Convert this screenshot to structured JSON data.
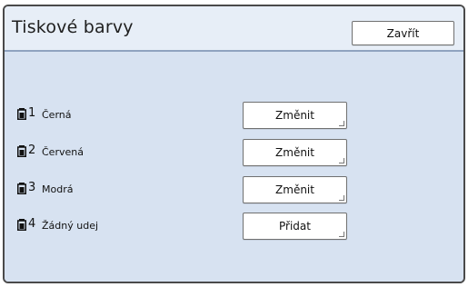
{
  "header": {
    "title": "Tiskové barvy",
    "close_label": "Zavřít"
  },
  "drums": [
    {
      "number": "1",
      "color_name": "Černá",
      "action_label": "Změnit"
    },
    {
      "number": "2",
      "color_name": "Červená",
      "action_label": "Změnit"
    },
    {
      "number": "3",
      "color_name": "Modrá",
      "action_label": "Změnit"
    },
    {
      "number": "4",
      "color_name": "Žádný udej",
      "action_label": "Přidat"
    }
  ],
  "icons": {
    "drum": "ink-drum-icon"
  },
  "colors": {
    "panel_background": "#d7e2f1",
    "header_background": "#e7eef7",
    "border": "#4a4a4a",
    "button_background": "#ffffff"
  }
}
